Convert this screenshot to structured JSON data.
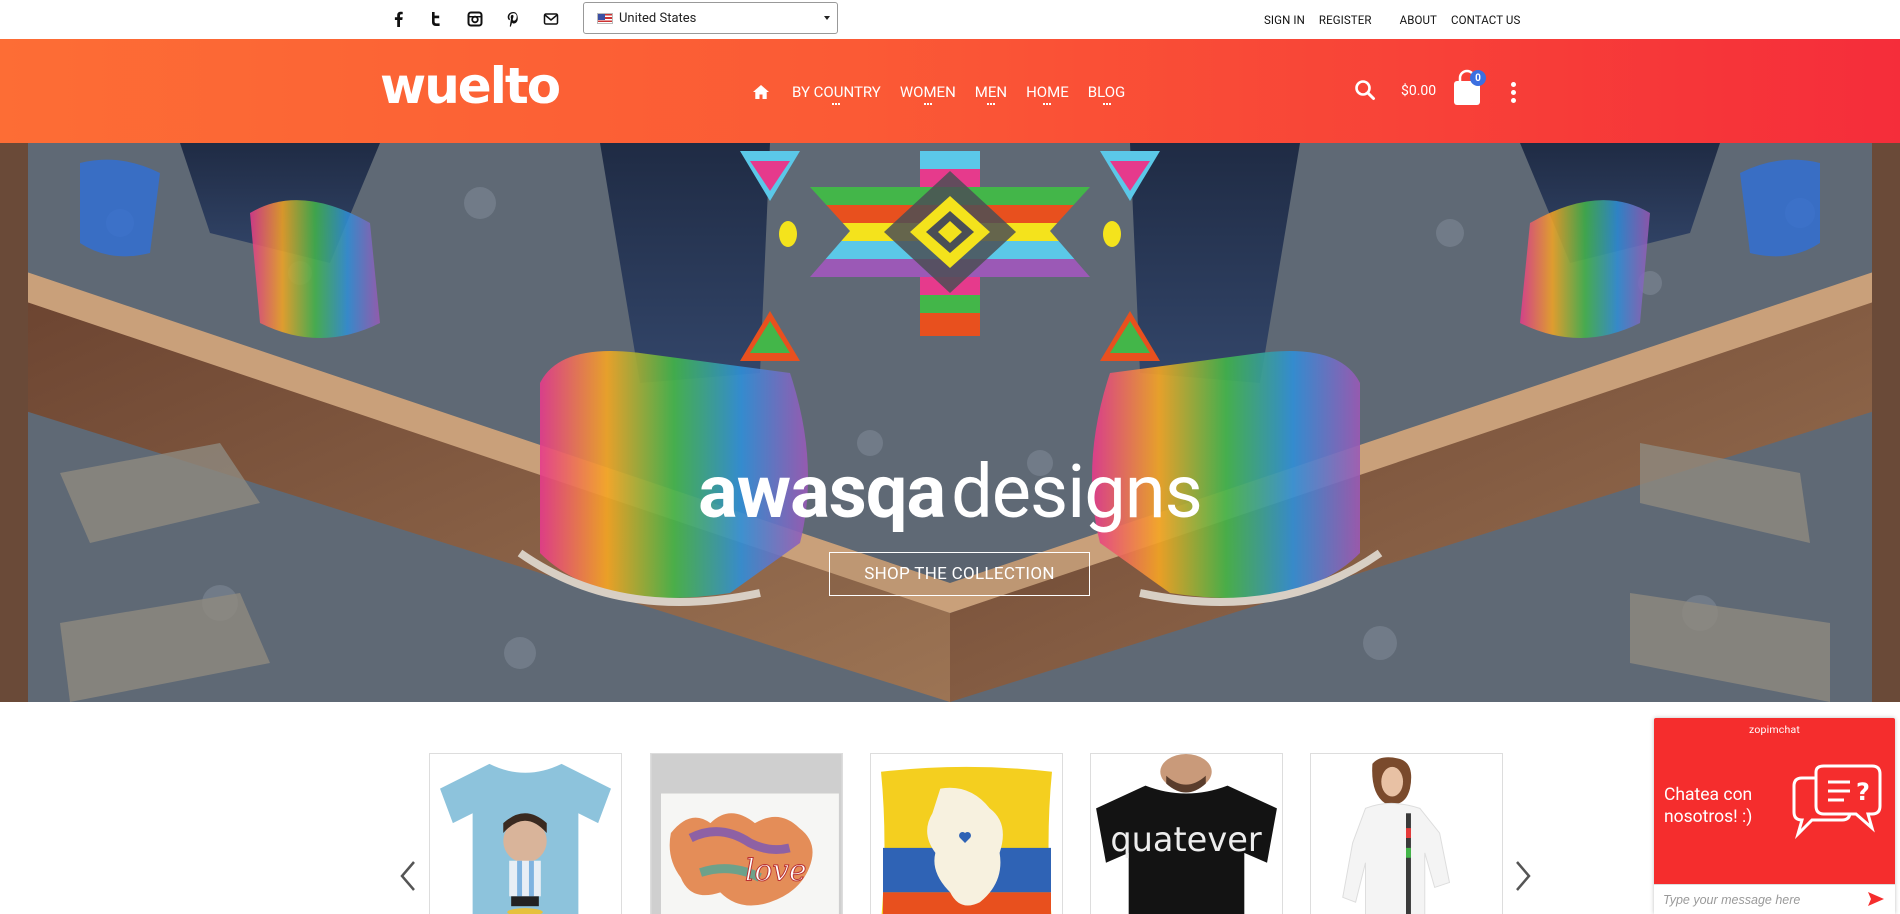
{
  "topbar": {
    "social": [
      {
        "name": "facebook-icon"
      },
      {
        "name": "twitter-icon"
      },
      {
        "name": "instagram-icon"
      },
      {
        "name": "pinterest-icon"
      },
      {
        "name": "mail-icon"
      }
    ],
    "country": "United States",
    "sign_in": "SIGN IN",
    "register": "REGISTER",
    "about": "ABOUT",
    "contact": "CONTACT US"
  },
  "header": {
    "logo": "wuelto",
    "nav": [
      "BY COUNTRY",
      "WOMEN",
      "MEN",
      "HOME",
      "BLOG"
    ],
    "cart_total": "$0.00",
    "cart_count": "0"
  },
  "hero": {
    "brand_bold": "awasqa",
    "brand_light": "designs",
    "cta": "SHOP THE COLLECTION"
  },
  "carousel": {
    "products": [
      {
        "name": "soccer-player-tshirt"
      },
      {
        "name": "venezuela-love-print"
      },
      {
        "name": "colombia-map-pillow"
      },
      {
        "name": "quatever-tshirt"
      },
      {
        "name": "white-tshirt-model"
      }
    ]
  },
  "chat": {
    "brand": "zopimchat",
    "message_line1": "Chatea con",
    "message_line2": "nosotros! :)",
    "placeholder": "Type your message here"
  },
  "colors": {
    "header_start": "#fd6d35",
    "header_end": "#f52d3a",
    "chat_bg": "#f52d2d",
    "badge": "#3b6fe0"
  }
}
